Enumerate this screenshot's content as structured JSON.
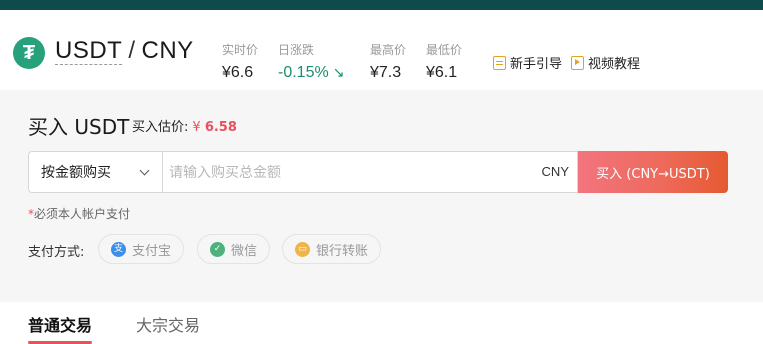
{
  "header": {
    "pair_base": "USDT",
    "pair_separator": "/",
    "pair_quote": "CNY",
    "logo_glyph": "₮",
    "stats": [
      {
        "label": "实时价",
        "value": "¥6.6"
      },
      {
        "label": "日涨跌",
        "value": "-0.15%",
        "arrow": "↘"
      },
      {
        "label": "最高价",
        "value": "¥7.3"
      },
      {
        "label": "最低价",
        "value": "¥6.1"
      }
    ],
    "links": [
      {
        "label": "新手引导",
        "icon": "guide-icon"
      },
      {
        "label": "视频教程",
        "icon": "video-icon"
      }
    ]
  },
  "buy": {
    "title": "买入 USDT",
    "estimate_label": "买入估价:",
    "estimate_symbol": "¥",
    "estimate_value": "6.58",
    "mode_select": "按金额购买",
    "amount_placeholder": "请输入购买总金额",
    "unit": "CNY",
    "submit": "买入 (CNY→USDT)",
    "note_star": "*",
    "note": "必须本人帐户支付",
    "payment_label": "支付方式:",
    "payments": [
      {
        "label": "支付宝",
        "icon": "alipay-icon",
        "glyph": "支"
      },
      {
        "label": "微信",
        "icon": "wechat-icon",
        "glyph": "✓"
      },
      {
        "label": "银行转账",
        "icon": "bank-icon",
        "glyph": "▭"
      }
    ]
  },
  "tabs": [
    {
      "label": "普通交易",
      "active": true
    },
    {
      "label": "大宗交易",
      "active": false
    }
  ],
  "colors": {
    "brand_dark": "#0f4a4c",
    "tether_green": "#26a17b",
    "accent_red": "#e8505b",
    "down_green": "#1a8f6e",
    "link_icon_orange": "#e0a326"
  }
}
